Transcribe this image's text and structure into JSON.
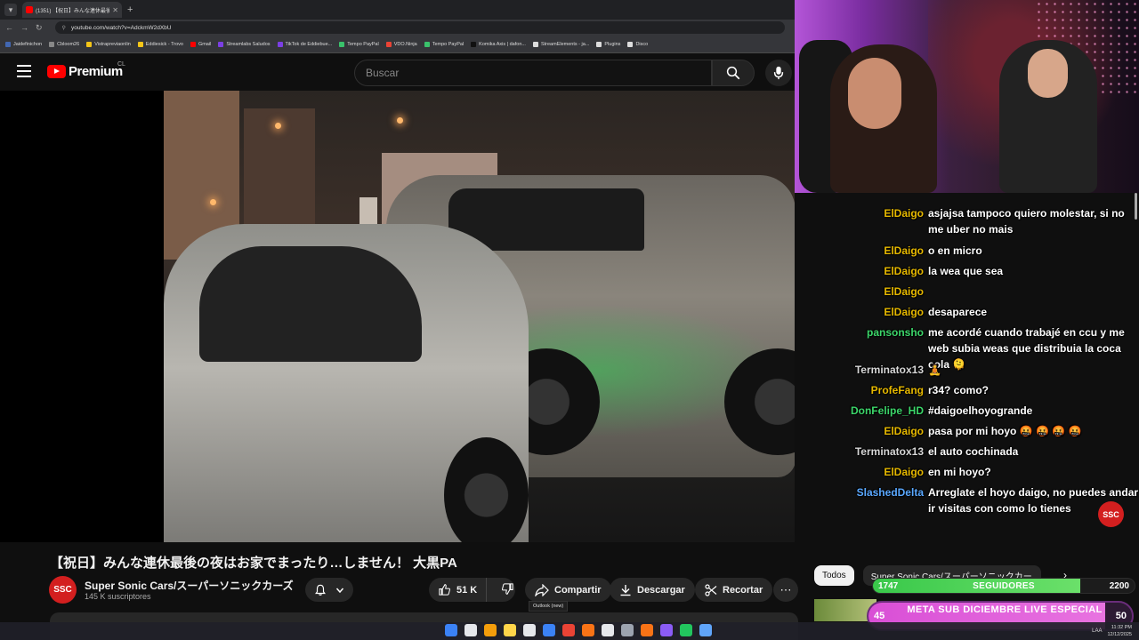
{
  "browser": {
    "tab_title": "(1351) 【祝日】みんな連休最後の",
    "url": "youtube.com/watch?v=AdckmW2dXbU",
    "bookmarks": [
      "Jaidefinichon",
      "Cbloom26",
      "Vistrapreviaonlin",
      "Eddiesick - Trovo",
      "Gmail",
      "Streamlabs Saludos",
      "TikTok de Eddiebue...",
      "Tempo PayPal",
      "VDO.Ninja",
      "Tempo PayPal",
      "Komika Axis | dafon...",
      "StreamElements - ja...",
      "Plugins",
      "Disco"
    ]
  },
  "youtube": {
    "logo_word": "Premium",
    "country": "CL",
    "search_placeholder": "Buscar"
  },
  "video": {
    "title": "【祝日】みんな連休最後の夜はお家でまったり…しません！ 大黒PA",
    "channel": "Super Sonic Cars/スーパーソニックカーズ",
    "channel_avatar": "SSC",
    "subscribers": "145 K suscriptores",
    "likes": "51 K",
    "share": "Compartir",
    "download": "Descargar",
    "clip": "Recortar",
    "tooltip": "Outlook (new)"
  },
  "sidebar": {
    "chip_all": "Todos",
    "chip_channel": "Super Sonic Cars/スーパーソニックカー..."
  },
  "chat": [
    {
      "user": "ElDaigo",
      "color": "#e6b800",
      "text": "asjajsa tampoco quiero molestar, si no me uber no mais"
    },
    {
      "user": "ElDaigo",
      "color": "#e6b800",
      "text": "o en micro"
    },
    {
      "user": "ElDaigo",
      "color": "#e6b800",
      "text": "la wea que sea"
    },
    {
      "user": "ElDaigo",
      "color": "#e6b800",
      "text": ""
    },
    {
      "user": "ElDaigo",
      "color": "#e6b800",
      "text": "desaparece"
    },
    {
      "user": "pansonsho",
      "color": "#3cd66a",
      "text": "me acordé cuando trabajé en ccu y me web subia weas que distribuia la coca cola 🫠"
    },
    {
      "user": "Terminatox13",
      "color": "#d8d8d8",
      "text": "🧘"
    },
    {
      "user": "ProfeFang",
      "color": "#e6b800",
      "text": "r34? como?"
    },
    {
      "user": "DonFelipe_HD",
      "color": "#3cd66a",
      "text": "#daigoelhoyogrande"
    },
    {
      "user": "ElDaigo",
      "color": "#e6b800",
      "text": "pasa por mi hoyo 🤬 🤬 🤬 🤬"
    },
    {
      "user": "Terminatox13",
      "color": "#d8d8d8",
      "text": "el auto cochinada"
    },
    {
      "user": "ElDaigo",
      "color": "#e6b800",
      "text": "en mi hoyo?"
    },
    {
      "user": "SlashedDelta",
      "color": "#5aa8ff",
      "text": "Arreglate el hoyo daigo, no puedes andar ir visitas con como lo tienes"
    }
  ],
  "goals": {
    "followers": {
      "current": "1747",
      "label": "SEGUIDORES",
      "target": "2200",
      "progress": 0.794
    },
    "subs": {
      "current": "45",
      "label": "META SUB DICIEMBRE LIVE ESPECIAL",
      "target": "50",
      "progress": 0.9
    }
  },
  "taskbar": {
    "lang": "LAA",
    "time": "11:32 PM",
    "date": "12/12/2025"
  },
  "colors": {
    "youtube_red": "#ff0000",
    "accent_green": "#39c84a",
    "accent_pink": "#d94fd6"
  }
}
